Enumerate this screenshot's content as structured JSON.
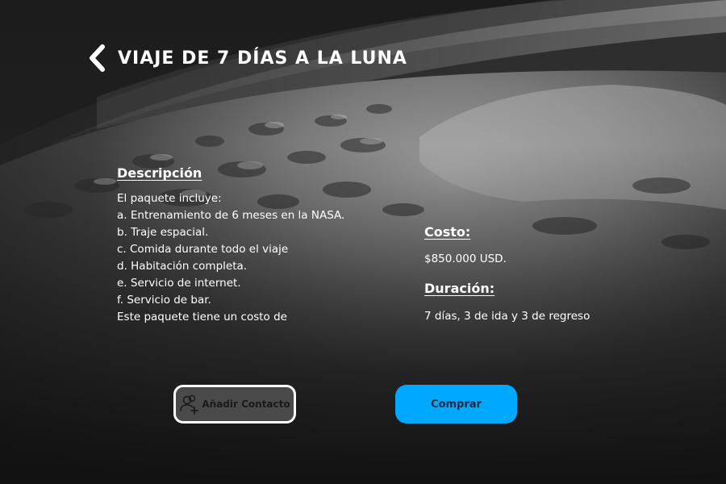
{
  "header": {
    "title": "Viaje de 7 días a la luna"
  },
  "icons": {
    "back": "chevron-left-icon",
    "contact": "add-user-icon"
  },
  "description": {
    "heading": "Descripción",
    "lines": [
      "El paquete incluye:",
      "a. Entrenamiento de 6 meses en la NASA.",
      "b. Traje espacial.",
      "c. Comida durante todo el viaje",
      "d. Habitación completa.",
      "e. Servicio de internet.",
      "f. Servicio de bar.",
      "Este paquete tiene un costo de"
    ]
  },
  "cost": {
    "heading": "Costo:",
    "value": "$850.000 USD."
  },
  "duration": {
    "heading": "Duración:",
    "value": "7 días,  3 de ida y 3 de regreso"
  },
  "buttons": {
    "add_contact": "Añadir Contacto",
    "buy": "Comprar"
  },
  "colors": {
    "accent": "#00a8ff",
    "text": "#ffffff",
    "background": "#1b1b1b"
  }
}
